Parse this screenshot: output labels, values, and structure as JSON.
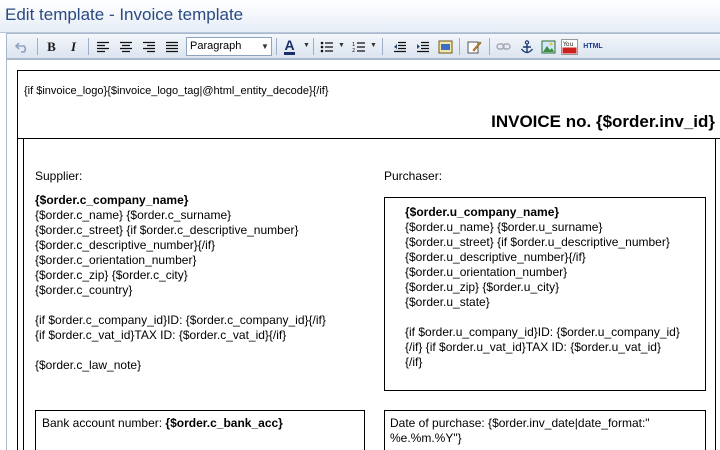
{
  "window": {
    "title": "Edit template - Invoice template"
  },
  "toolbar": {
    "format_select": "Paragraph",
    "buttons": [
      "undo-icon",
      "bold-icon",
      "italic-icon",
      "align-left-icon",
      "align-center-icon",
      "align-right-icon",
      "align-justify-icon",
      "font-color-icon",
      "bullet-list-icon",
      "numbered-list-icon",
      "outdent-icon",
      "indent-icon",
      "image-icon",
      "edit-icon",
      "link-icon",
      "anchor-icon",
      "picture-icon",
      "youtube-icon",
      "html-icon"
    ],
    "bold_label": "B",
    "italic_label": "I",
    "font_color_label": "A",
    "youtube_label": "You",
    "html_label": "HTML"
  },
  "document": {
    "logo_line": "{if $invoice_logo}{$invoice_logo_tag|@html_entity_decode}{/if}",
    "invoice_title": "INVOICE no. {$order.inv_id}",
    "supplier": {
      "label": "Supplier:",
      "company": "{$order.c_company_name}",
      "lines1": [
        "{$order.c_name} {$order.c_surname}",
        "{$order.c_street} {if $order.c_descriptive_number}",
        "{$order.c_descriptive_number}{/if}",
        "{$order.c_orientation_number}",
        "{$order.c_zip} {$order.c_city}",
        "{$order.c_country}"
      ],
      "lines2": [
        "{if $order.c_company_id}ID: {$order.c_company_id}{/if}",
        "{if $order.c_vat_id}TAX ID: {$order.c_vat_id}{/if}"
      ],
      "law_note": "{$order.c_law_note}"
    },
    "purchaser": {
      "label": "Purchaser:",
      "company": "{$order.u_company_name}",
      "lines1": [
        "{$order.u_name} {$order.u_surname}",
        "{$order.u_street} {if $order.u_descriptive_number}",
        "{$order.u_descriptive_number}{/if}",
        "{$order.u_orientation_number}",
        "{$order.u_zip} {$order.u_city}",
        "{$order.u_state}"
      ],
      "lines2": [
        "{if $order.u_company_id}ID: {$order.u_company_id}",
        "{/if} {if $order.u_vat_id}TAX ID: {$order.u_vat_id}",
        "{/if}"
      ]
    },
    "bank": {
      "label": "Bank account number:",
      "value": "{$order.c_bank_acc}"
    },
    "date": {
      "line1": "Date of purchase: {$order.inv_date|date_format:\"",
      "line2": "%e.%m.%Y\"}"
    }
  }
}
